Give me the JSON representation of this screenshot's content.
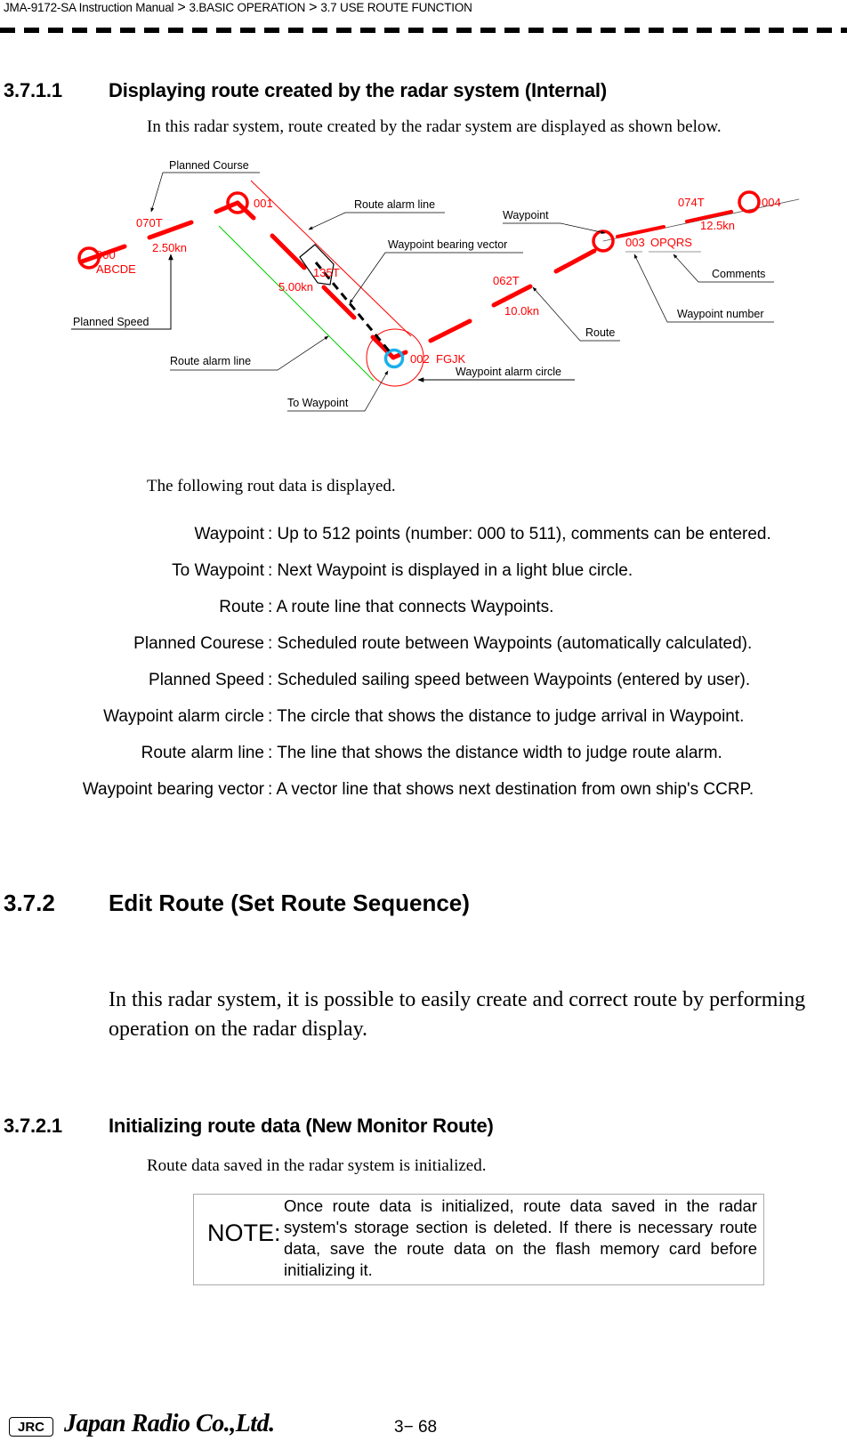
{
  "header": {
    "breadcrumb": [
      "JMA-9172-SA Instruction Manual",
      "3.BASIC OPERATION",
      "3.7  USE ROUTE FUNCTION"
    ],
    "separator": ">"
  },
  "section_3711": {
    "number": "3.7.1.1",
    "title": "Displaying route created by the radar system (Internal)",
    "intro": "In this radar system, route created by the radar system are displayed as shown below."
  },
  "diagram": {
    "colors": {
      "route": "#ff0000",
      "alarm_line_starboard": "#ff0000",
      "alarm_line_port": "#00cc00",
      "to_waypoint": "#1ab0ea",
      "callout": "#000000"
    },
    "waypoints": [
      {
        "number": "000",
        "comment": "ABCDE"
      },
      {
        "number": "001",
        "comment": ""
      },
      {
        "number": "002",
        "comment": "FGJK"
      },
      {
        "number": "003",
        "comment": "OPQRS"
      },
      {
        "number": "004",
        "comment": ""
      }
    ],
    "legs": [
      {
        "course": "070T",
        "speed": "2.50kn"
      },
      {
        "course": "135T",
        "speed": "5.00kn"
      },
      {
        "course": "062T",
        "speed": "10.0kn"
      },
      {
        "course": "074T",
        "speed": "12.5kn"
      }
    ],
    "callouts": {
      "planned_course": "Planned Course",
      "planned_speed": "Planned Speed",
      "route_alarm_line_top": "Route alarm line",
      "route_alarm_line_bottom": "Route alarm line",
      "waypoint_bearing_vector": "Waypoint bearing vector",
      "to_waypoint": "To Waypoint",
      "waypoint_alarm_circle": "Waypoint alarm circle",
      "waypoint": "Waypoint",
      "route": "Route",
      "comments": "Comments",
      "waypoint_number": "Waypoint number"
    }
  },
  "route_data": {
    "intro": "The following rout data is displayed.",
    "definitions": [
      {
        "term": "Waypoint",
        "desc": ": Up to 512 points (number: 000 to 511), comments can be entered."
      },
      {
        "term": "To Waypoint",
        "desc": ": Next Waypoint is displayed in a light blue circle."
      },
      {
        "term": "Route",
        "desc": ": A route line that connects Waypoints."
      },
      {
        "term": "Planned Courese",
        "desc": ": Scheduled route between Waypoints (automatically calculated)."
      },
      {
        "term": "Planned Speed",
        "desc": ": Scheduled sailing speed between Waypoints (entered by user)."
      },
      {
        "term": "Waypoint alarm circle",
        "desc": ": The circle that shows the distance to judge arrival in Waypoint."
      },
      {
        "term": "Route alarm line",
        "desc": ": The line that shows the distance width to judge route alarm."
      },
      {
        "term": "Waypoint bearing vector",
        "desc": ": A vector line that shows next destination from own ship's CCRP."
      }
    ]
  },
  "section_372": {
    "number": "3.7.2",
    "title": "Edit Route (Set Route Sequence)",
    "body": "In this radar system, it is possible to easily create and correct route by performing operation on the radar display."
  },
  "section_3721": {
    "number": "3.7.2.1",
    "title": "Initializing route data (New Monitor Route)",
    "body": "Route data saved in the radar system is initialized."
  },
  "note": {
    "label": "NOTE:",
    "text": "Once route data is initialized, route data saved in the radar system's storage section is deleted. If there is necessary route data, save the route data on the flash memory card before initializing it."
  },
  "footer": {
    "logo": "JRC",
    "company": "Japan Radio Co.,Ltd.",
    "page": "3− 68"
  }
}
